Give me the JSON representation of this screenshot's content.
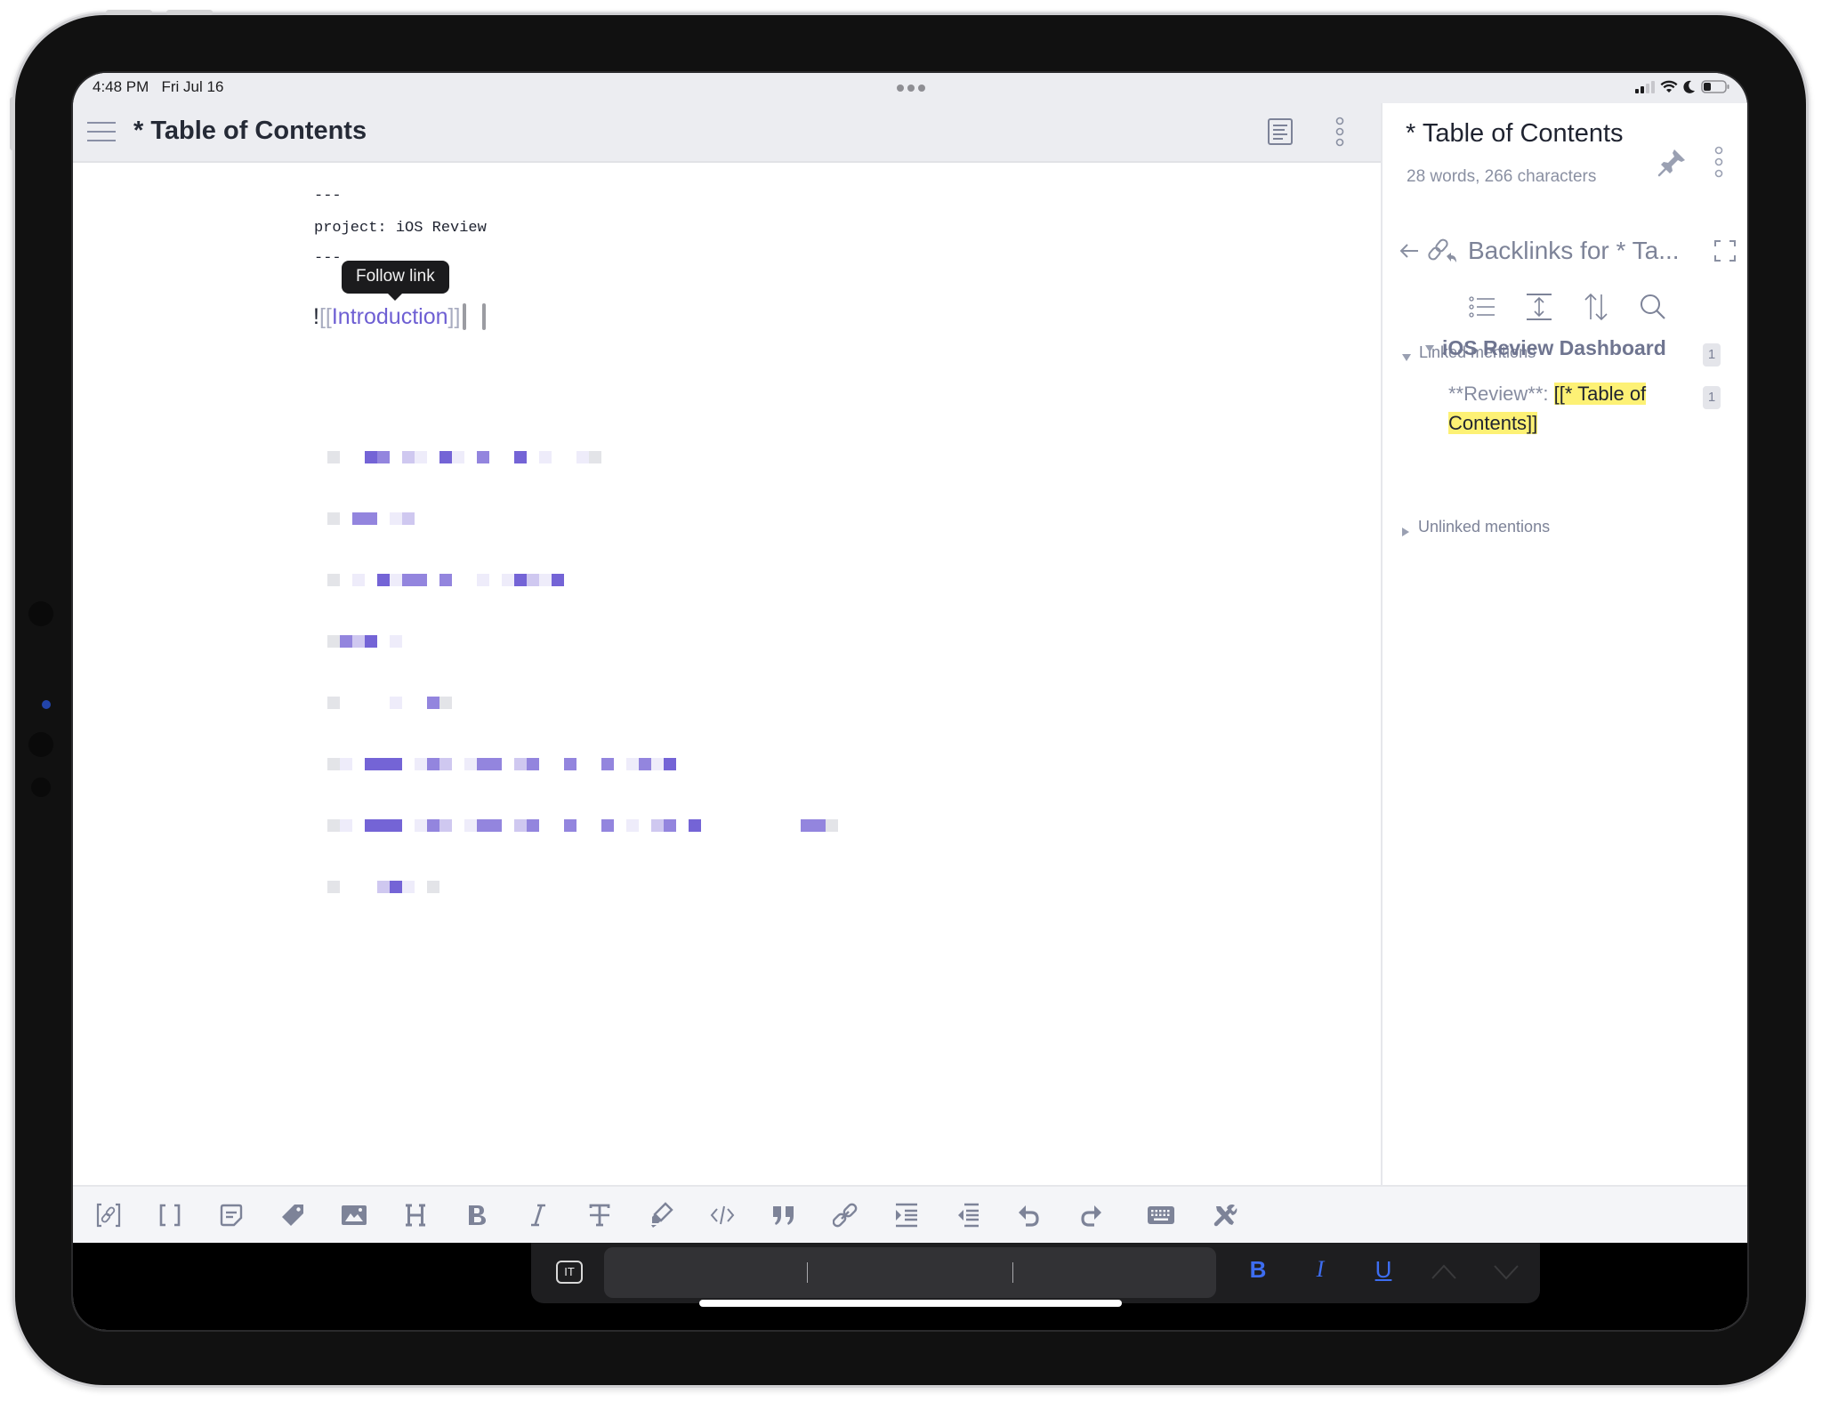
{
  "status_bar": {
    "time": "4:48 PM",
    "date": "Fri Jul 16",
    "icons": [
      "cellular-signal-icon",
      "wifi-icon",
      "do-not-disturb-moon-icon",
      "battery-icon"
    ]
  },
  "main_header": {
    "title": "* Table of Contents",
    "icons": [
      "hamburger-menu-icon",
      "outline-view-icon",
      "more-vertical-icon"
    ]
  },
  "editor": {
    "frontmatter": [
      "---",
      "project: iOS Review",
      "---"
    ],
    "embed": {
      "prefix": "!",
      "open_brackets": "[[",
      "link_text": "Introduction",
      "close_brackets": "]]"
    },
    "tooltip": "Follow link",
    "redacted_lines_count": 8,
    "link_color": "#6e5fd3"
  },
  "right_panel": {
    "title": "* Table of Contents",
    "stats": "28 words, 266 characters",
    "backlinks_title": "Backlinks for * Ta...",
    "tools": [
      "list-view-icon",
      "expand-collapse-icon",
      "sort-icon",
      "search-icon"
    ],
    "linked_mentions": {
      "label": "Linked mentions",
      "count": "1",
      "files": [
        {
          "name": "iOS Review Dashboard",
          "count": "1",
          "snippet_prefix": "**Review**: ",
          "snippet_highlight_1": "[[* Table of",
          "snippet_highlight_2": "Contents]]"
        }
      ]
    },
    "unlinked_mentions": {
      "label": "Unlinked mentions"
    },
    "highlight_color": "#fdf175"
  },
  "toolbar": {
    "tools": [
      "embed-link-icon",
      "brackets-icon",
      "note-icon",
      "tag-icon",
      "image-icon",
      "heading-icon",
      "bold-icon",
      "italic-icon",
      "strikethrough-icon",
      "highlight-icon",
      "code-icon",
      "quote-icon",
      "link-icon",
      "indent-icon",
      "outdent-icon",
      "undo-icon",
      "redo-icon",
      "keyboard-icon",
      "tools-icon"
    ]
  },
  "keyboard_bar": {
    "input_mode": "IT",
    "bold": "B",
    "italic": "I",
    "underline": "U",
    "accent_color": "#3d6df0"
  }
}
